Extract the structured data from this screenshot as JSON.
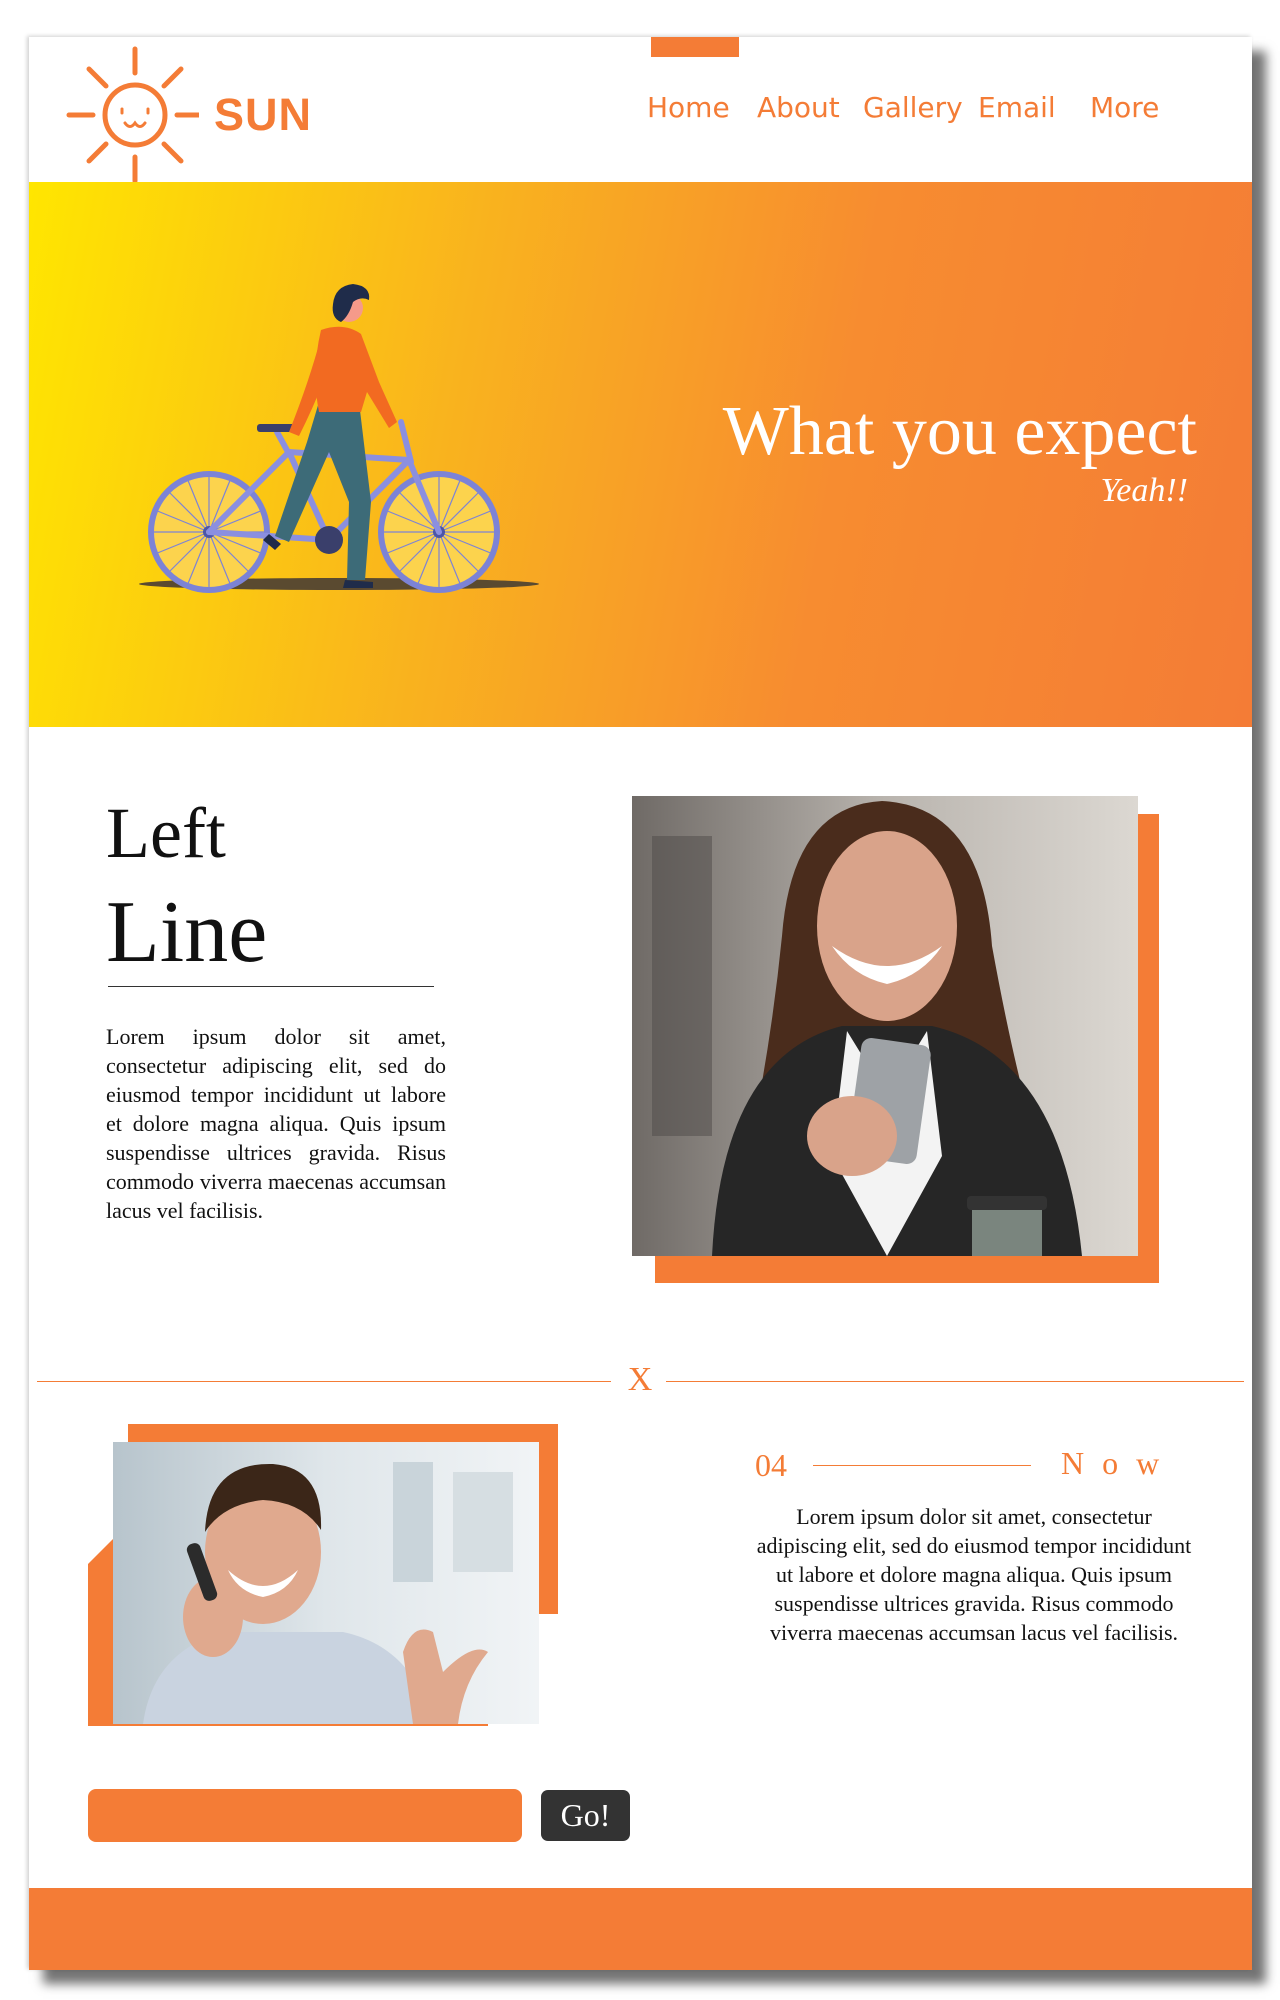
{
  "brand": {
    "name": "SUN",
    "logo_icon": "sun-face-icon"
  },
  "nav": {
    "items": [
      "Home",
      "About",
      "Gallery",
      "Email",
      "More"
    ]
  },
  "hero": {
    "title": "What you expect",
    "subtitle": "Yeah!!",
    "illustration": "woman-walking-bicycle-illustration"
  },
  "section1": {
    "heading_small": "Left",
    "heading_large": "Line",
    "body": "Lorem ipsum dolor sit amet, consectetur adipiscing elit, sed do eiusmod tempor incididunt ut labore et dolore magna aliqua. Quis ipsum suspendisse ultrices gravida. Risus commodo viverra maecenas accumsan lacus vel facilisis.",
    "photo": "woman-with-phone-photo"
  },
  "divider": {
    "label": "X"
  },
  "section2": {
    "number": "04",
    "label": "Now",
    "body": "Lorem ipsum dolor sit amet, consectetur adipiscing elit, sed do eiusmod tempor incididunt ut labore et dolore magna aliqua. Quis ipsum suspendisse ultrices gravida. Risus commodo viverra maecenas accumsan lacus vel facilisis.",
    "photo": "man-on-phone-photo"
  },
  "form": {
    "input_value": "",
    "button_label": "Go!"
  },
  "colors": {
    "accent": "#f47c36",
    "hero_start": "#ffe600",
    "button": "#333333"
  }
}
